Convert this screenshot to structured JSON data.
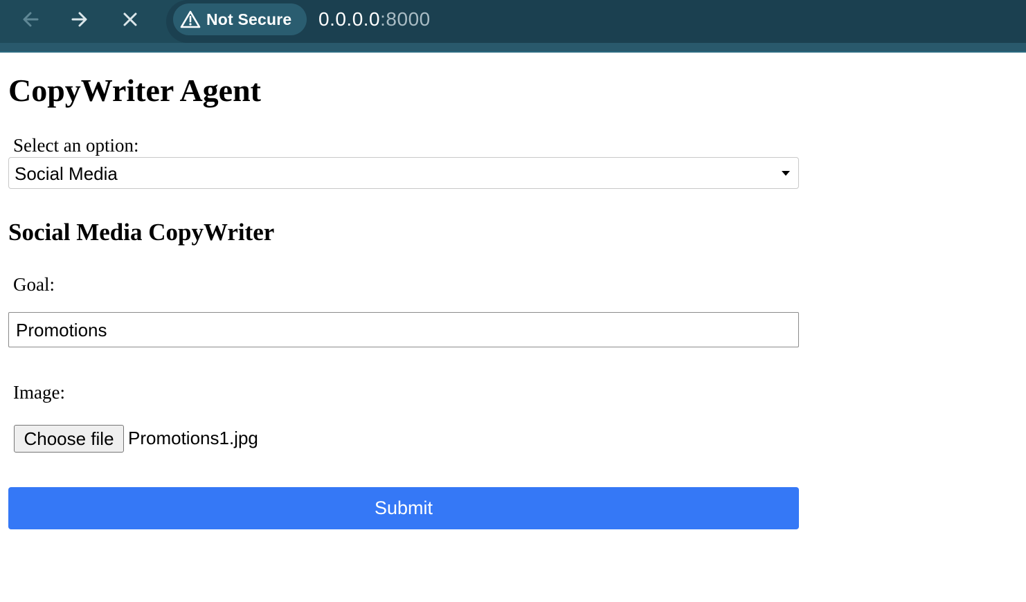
{
  "browser": {
    "security_label": "Not Secure",
    "url_host": "0.0.0.0",
    "url_port": ":8000",
    "icons": {
      "back": "arrow-left-icon",
      "forward": "arrow-right-icon",
      "stop": "close-icon",
      "security": "warning-triangle-icon"
    }
  },
  "page": {
    "title": "CopyWriter Agent",
    "select_label": "Select an option:",
    "select_value": "Social Media",
    "section_title": "Social Media CopyWriter",
    "goal_label": "Goal:",
    "goal_value": "Promotions",
    "image_label": "Image:",
    "file_button_label": "Choose file",
    "file_name": "Promotions1.jpg",
    "submit_label": "Submit"
  },
  "colors": {
    "chrome_bg": "#1f4a5a",
    "submit_bg": "#3578f6",
    "submit_text": "#ffffff"
  }
}
